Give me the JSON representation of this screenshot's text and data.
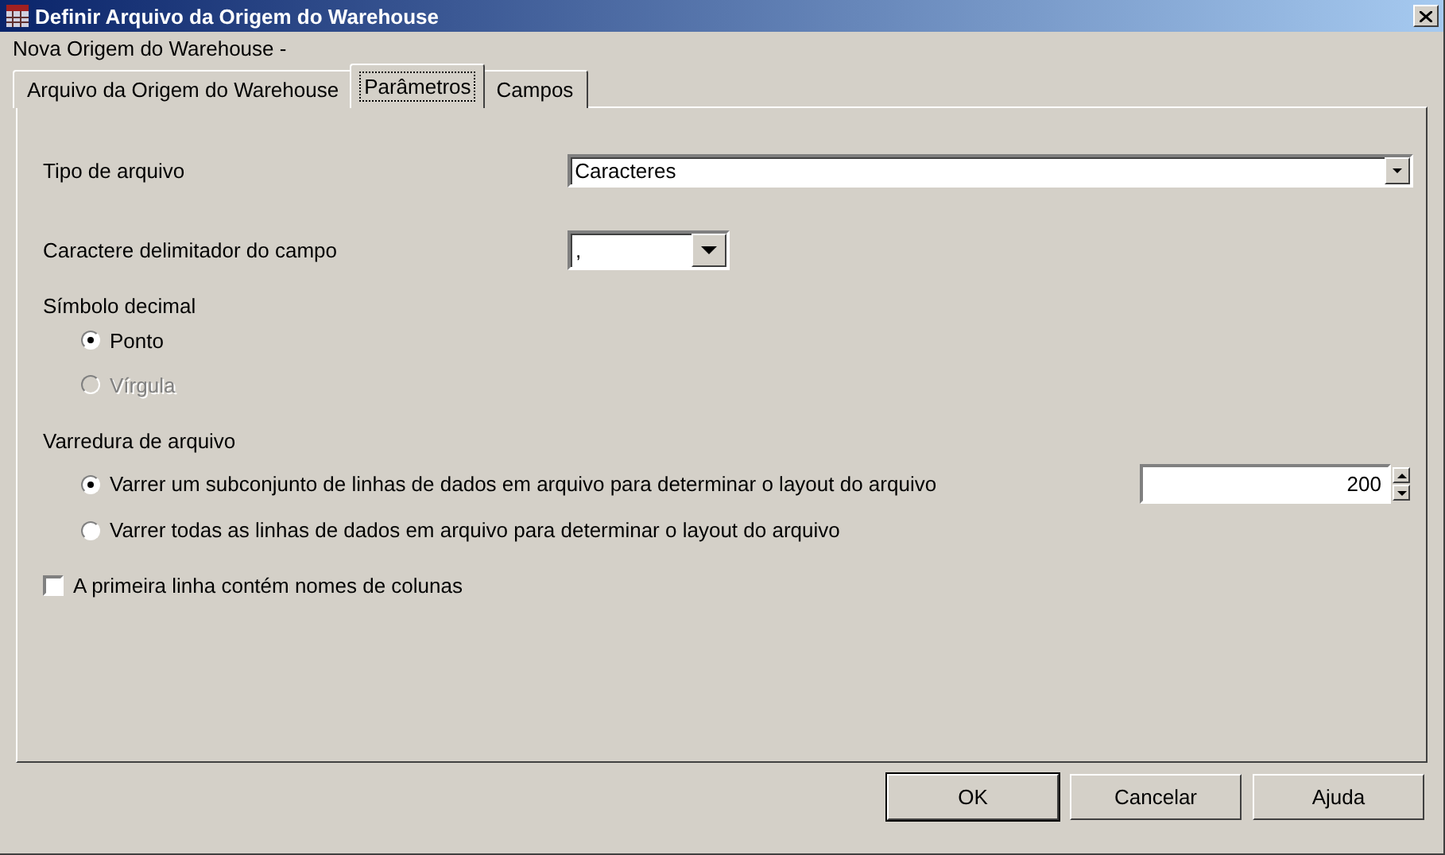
{
  "window": {
    "title": "Definir Arquivo da Origem do Warehouse",
    "subtitle": "Nova Origem do Warehouse -"
  },
  "tabs": [
    {
      "label": "Arquivo da Origem do Warehouse",
      "selected": false
    },
    {
      "label": "Parâmetros",
      "selected": true
    },
    {
      "label": "Campos",
      "selected": false
    }
  ],
  "fields": [
    {
      "kind": "combo",
      "label": "Tipo de arquivo",
      "value": "Caracteres"
    },
    {
      "kind": "dropdown",
      "label": "Caractere delimitador do campo",
      "value": ","
    }
  ],
  "decimal_symbol": {
    "label": "Símbolo decimal",
    "options": [
      {
        "label": "Ponto",
        "selected": true,
        "disabled": false
      },
      {
        "label": "Vírgula",
        "selected": false,
        "disabled": true
      }
    ]
  },
  "file_scan": {
    "label": "Varredura de arquivo",
    "options": [
      {
        "label": "Varrer um subconjunto de linhas de dados em arquivo para determinar o layout do arquivo",
        "selected": true,
        "disabled": false,
        "spinner": "200"
      },
      {
        "label": "Varrer todas as linhas de dados em arquivo para determinar o layout do arquivo",
        "selected": false,
        "disabled": false
      }
    ]
  },
  "first_row_headers": {
    "label": "A primeira linha contém nomes de colunas",
    "checked": false
  },
  "buttons": [
    "OK",
    "Cancelar",
    "Ajuda"
  ]
}
